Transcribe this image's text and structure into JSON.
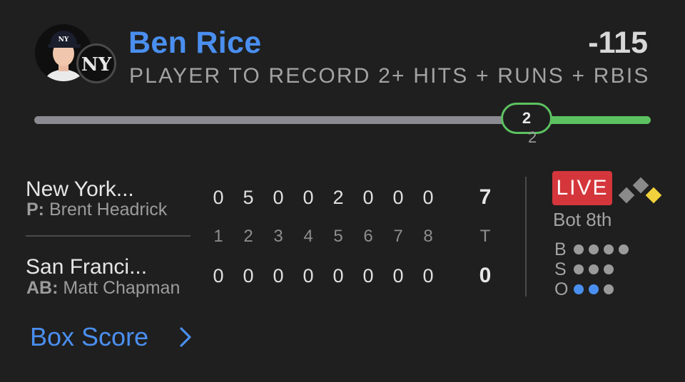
{
  "player": {
    "name": "Ben Rice",
    "odds": "-115",
    "market": "PLAYER TO RECORD 2+ HITS + RUNS + RBIS"
  },
  "progress": {
    "marker_label": "2",
    "marker_sublabel": "2",
    "fraction": 0.76
  },
  "game": {
    "away": {
      "team": "New York...",
      "role_label": "P:",
      "player": "Brent Headrick",
      "innings": [
        "0",
        "5",
        "0",
        "0",
        "2",
        "0",
        "0",
        "0"
      ],
      "total": "7"
    },
    "home": {
      "team": "San Franci...",
      "role_label": "AB:",
      "player": "Matt Chapman",
      "innings": [
        "0",
        "0",
        "0",
        "0",
        "0",
        "0",
        "0",
        "0",
        "0"
      ],
      "total": "0"
    },
    "inning_headers": [
      "1",
      "2",
      "3",
      "4",
      "5",
      "6",
      "7",
      "8"
    ],
    "total_header": "T"
  },
  "status": {
    "live_label": "LIVE",
    "inning": "Bot 8th",
    "balls_label": "B",
    "balls": 0,
    "balls_max": 4,
    "strikes_label": "S",
    "strikes": 0,
    "strikes_max": 3,
    "outs_label": "O",
    "outs": 2,
    "outs_max": 3,
    "bases": {
      "first": true,
      "second": false,
      "third": false
    }
  },
  "footer": {
    "link_label": "Box Score",
    "chevron": "chevron-right-icon"
  },
  "colors": {
    "accent": "#4a8ff0",
    "progress": "#5cc261",
    "live": "#d4363c",
    "runner": "#f2d23c"
  }
}
